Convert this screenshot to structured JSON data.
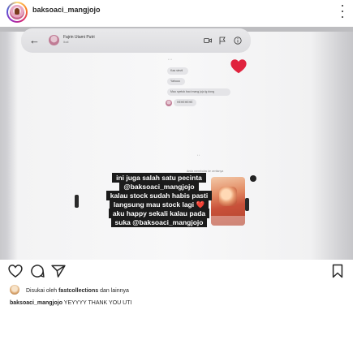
{
  "post": {
    "username": "baksoaci_mangjojo"
  },
  "story": {
    "account_name": "Fajrin Utami Putri",
    "account_sub": "Ikuti",
    "reply_1": "Kaa stevii",
    "reply_2": "Yahuuu",
    "reply_3": "Mau nyetok baci mang jojo lg dong",
    "reply_4": "HEHEHEHE",
    "reply_time": "Anda membalas ke ceritanya",
    "caption_lines": [
      "ini juga salah satu pecinta",
      "@baksoaci_mangjojo",
      "kalau stock sudah habis pasti",
      "langsung mau stock lagi ❤️",
      "aku happy sekali kalau pada",
      "suka @baksoaci_mangjojo"
    ]
  },
  "likes": {
    "prefix": "Disukai oleh",
    "user": "fastcollections",
    "suffix": "dan lainnya"
  },
  "caption": {
    "user": "baksoaci_mangjojo",
    "text": "YEYYYY THANK YOU UTI"
  },
  "icons": {
    "like": "heart-outline-icon",
    "comment": "comment-icon",
    "share": "send-icon",
    "save": "bookmark-icon",
    "more": "more-vertical-icon"
  },
  "colors": {
    "heart": "#e0233e",
    "caption_bg": "#1b1b1b"
  }
}
